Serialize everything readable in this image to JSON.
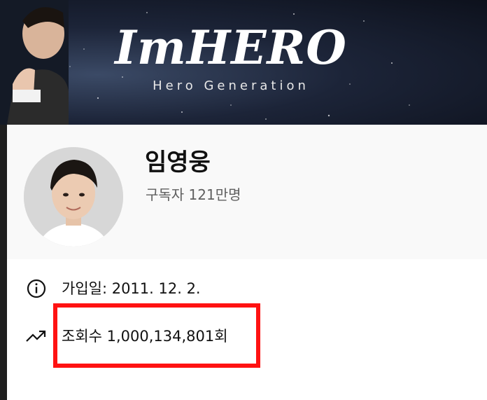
{
  "banner": {
    "title": "ImHERO",
    "subtitle": "Hero Generation"
  },
  "channel": {
    "name": "임영웅",
    "subscribers": "구독자 121만명"
  },
  "about": {
    "joined": "가입일: 2011. 12. 2.",
    "views": "조회수 1,000,134,801회"
  },
  "icons": {
    "info": "info-icon",
    "views": "trending-up-icon"
  },
  "colors": {
    "highlight": "#ff1212",
    "background": "#f9f9f9",
    "subtext": "#606060"
  }
}
